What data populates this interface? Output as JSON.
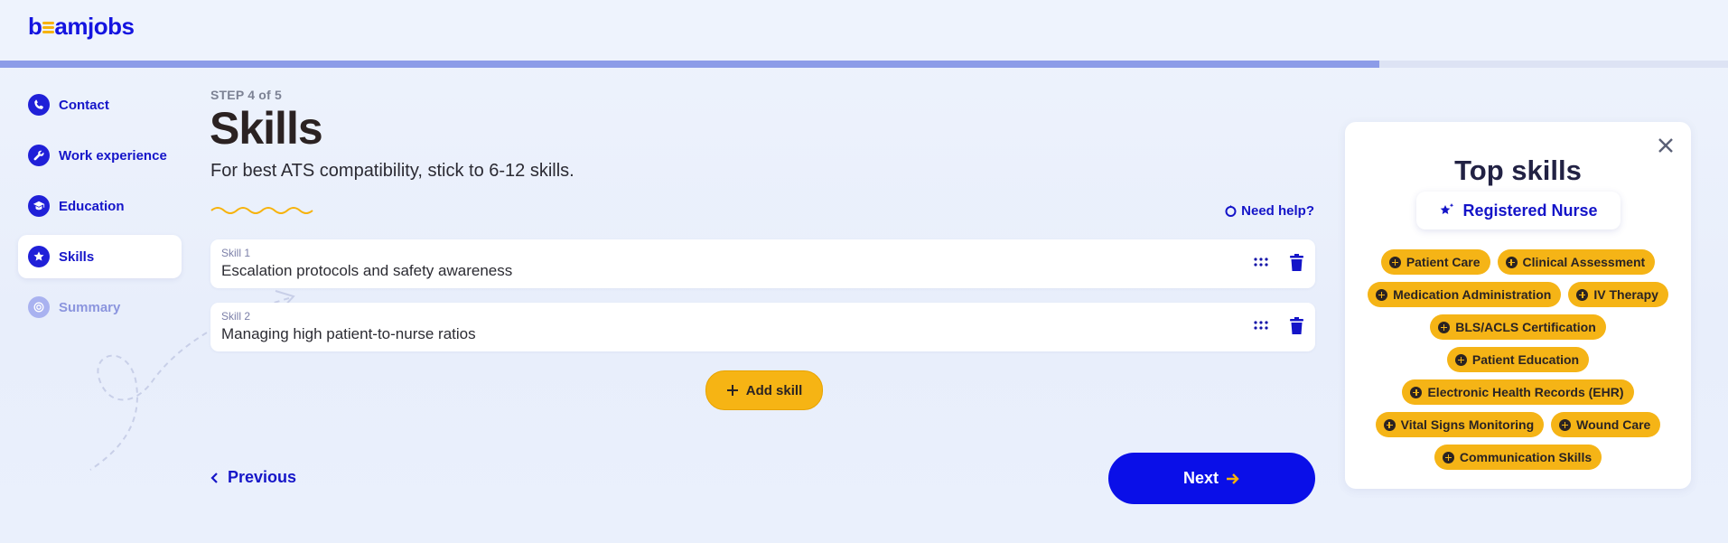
{
  "brand": {
    "logo_text_left": "b",
    "logo_text_right": "amjobs"
  },
  "progress": {
    "fraction": 0.798
  },
  "sidebar": {
    "items": [
      {
        "label": "Contact",
        "icon": "phone-icon",
        "state": "done"
      },
      {
        "label": "Work experience",
        "icon": "wrench-icon",
        "state": "done"
      },
      {
        "label": "Education",
        "icon": "graduation-cap-icon",
        "state": "done"
      },
      {
        "label": "Skills",
        "icon": "star-icon",
        "state": "active"
      },
      {
        "label": "Summary",
        "icon": "target-icon",
        "state": "upcoming"
      }
    ]
  },
  "main": {
    "step": "STEP 4 of 5",
    "title": "Skills",
    "subtitle": "For best ATS compatibility, stick to 6-12 skills.",
    "help": "Need help?",
    "skills": [
      {
        "label": "Skill 1",
        "value": "Escalation protocols and safety awareness"
      },
      {
        "label": "Skill 2",
        "value": "Managing high patient-to-nurse ratios"
      }
    ],
    "add_skill": "Add skill",
    "previous": "Previous",
    "next": "Next"
  },
  "top_skills": {
    "title": "Top skills",
    "job_title": "Registered Nurse",
    "tags": [
      [
        "Patient Care",
        "Clinical Assessment"
      ],
      [
        "Medication Administration",
        "IV Therapy"
      ],
      [
        "BLS/ACLS Certification"
      ],
      [
        "Patient Education"
      ],
      [
        "Electronic Health Records (EHR)"
      ],
      [
        "Vital Signs Monitoring",
        "Wound Care"
      ],
      [
        "Communication Skills"
      ]
    ]
  },
  "colors": {
    "brand_blue": "#0a0fe8",
    "accent_yellow": "#f5b416",
    "nav_blue": "#1515c9"
  }
}
